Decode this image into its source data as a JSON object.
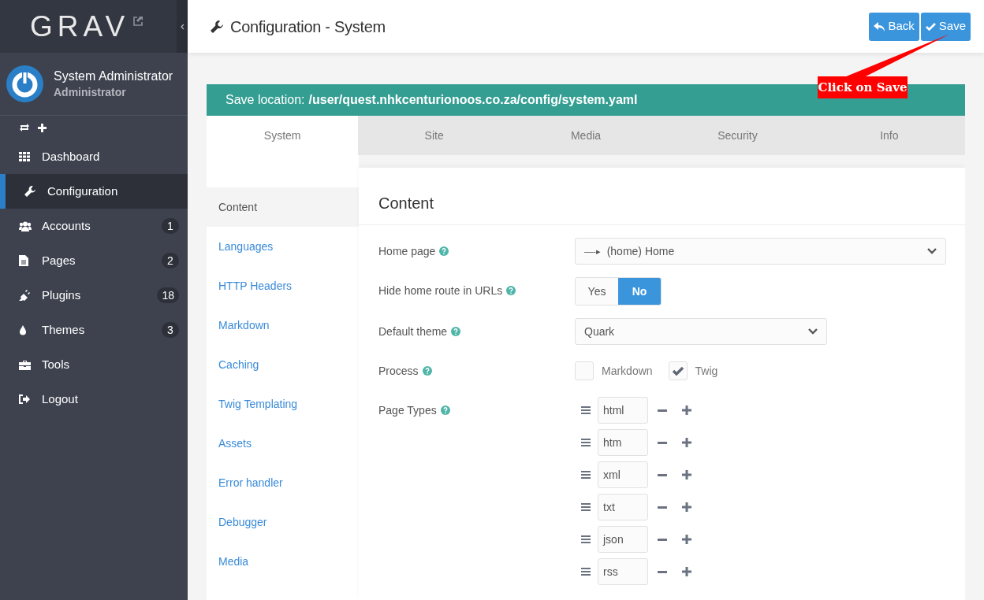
{
  "logo": "GRAV",
  "user": {
    "name": "System Administrator",
    "role": "Administrator"
  },
  "nav": [
    {
      "kind": "dashboard",
      "label": "Dashboard",
      "selected": false
    },
    {
      "kind": "configuration",
      "label": "Configuration",
      "selected": true
    },
    {
      "kind": "accounts",
      "label": "Accounts",
      "badge": "1",
      "selected": false
    },
    {
      "kind": "pages",
      "label": "Pages",
      "badge": "2",
      "selected": false
    },
    {
      "kind": "plugins",
      "label": "Plugins",
      "badge": "18",
      "selected": false
    },
    {
      "kind": "themes",
      "label": "Themes",
      "badge": "3",
      "selected": false
    },
    {
      "kind": "tools",
      "label": "Tools",
      "selected": false
    },
    {
      "kind": "logout",
      "label": "Logout",
      "selected": false
    }
  ],
  "header": {
    "title": "Configuration - System",
    "buttons": [
      {
        "kind": "back",
        "label": "Back"
      },
      {
        "kind": "save",
        "label": "Save"
      }
    ]
  },
  "callout": "Click on Save",
  "save_location": {
    "label": "Save location:",
    "path": "/user/quest.nhkcenturionoos.co.za/config/system.yaml"
  },
  "tabs": [
    {
      "label": "System",
      "selected": true
    },
    {
      "label": "Site",
      "selected": false
    },
    {
      "label": "Media",
      "selected": false
    },
    {
      "label": "Security",
      "selected": false
    },
    {
      "label": "Info",
      "selected": false
    }
  ],
  "subnav": [
    {
      "label": "Content",
      "selected": true
    },
    {
      "label": "Languages",
      "selected": false
    },
    {
      "label": "HTTP Headers",
      "selected": false
    },
    {
      "label": "Markdown",
      "selected": false
    },
    {
      "label": "Caching",
      "selected": false
    },
    {
      "label": "Twig Templating",
      "selected": false
    },
    {
      "label": "Assets",
      "selected": false
    },
    {
      "label": "Error handler",
      "selected": false
    },
    {
      "label": "Debugger",
      "selected": false
    },
    {
      "label": "Media",
      "selected": false
    }
  ],
  "section_title": "Content",
  "fields": [
    {
      "kind": "page_select",
      "label": "Home page",
      "prefix": "—-▸",
      "value": "(home) Home"
    },
    {
      "kind": "toggle",
      "label": "Hide home route in URLs",
      "options": [
        {
          "label": "Yes",
          "selected": false
        },
        {
          "label": "No",
          "selected": true
        }
      ]
    },
    {
      "kind": "select",
      "label": "Default theme",
      "value": "Quark"
    },
    {
      "kind": "checkboxes",
      "label": "Process",
      "options": [
        {
          "label": "Markdown",
          "checked": false
        },
        {
          "label": "Twig",
          "checked": true
        }
      ]
    },
    {
      "kind": "list",
      "label": "Page Types",
      "items": [
        "html",
        "htm",
        "xml",
        "txt",
        "json",
        "rss"
      ]
    }
  ]
}
